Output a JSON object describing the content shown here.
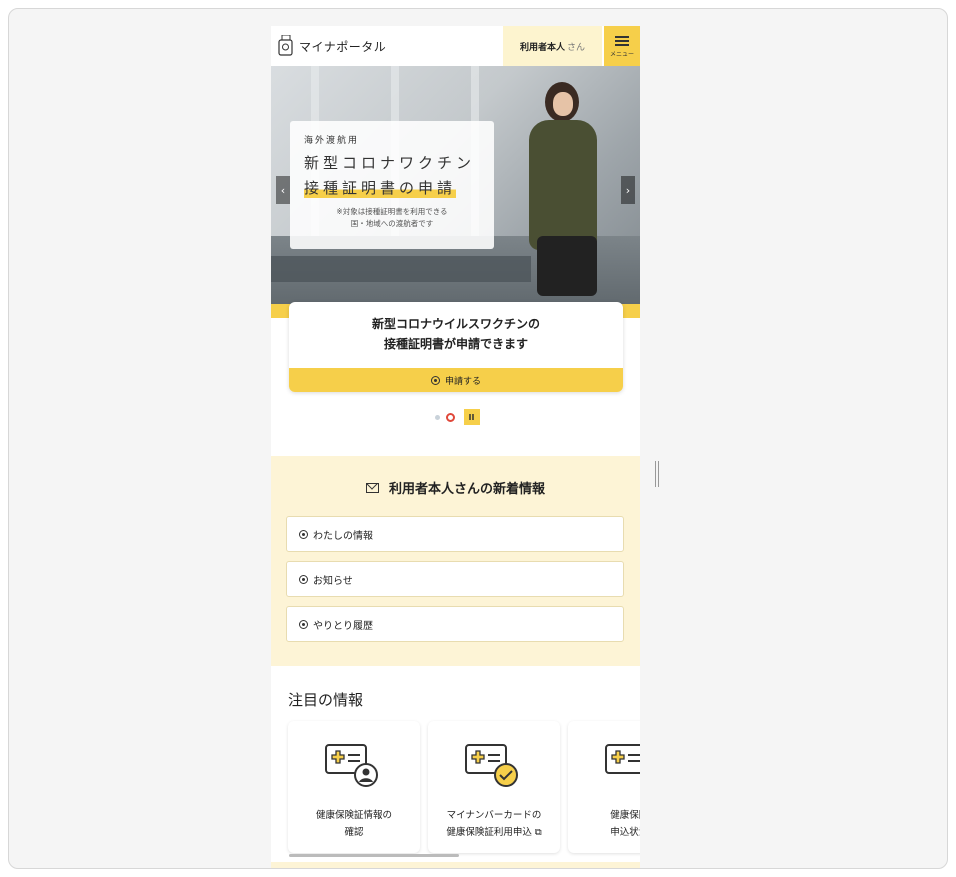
{
  "header": {
    "logo_text": "マイナポータル",
    "user_name": "利用者本人",
    "user_suffix": "さん",
    "menu_label": "メニュー"
  },
  "hero": {
    "line1": "海外渡航用",
    "line2": "新型コロナワクチン",
    "line3": "接種証明書の申請",
    "note1": "※対象は接種証明書を利用できる",
    "note2": "国・地域への渡航者です",
    "prev_arrow": "‹",
    "next_arrow": "›"
  },
  "slide_card": {
    "title1": "新型コロナウイルスワクチンの",
    "title2": "接種証明書が申請できます",
    "button": "申請する"
  },
  "carousel": {
    "pause_label": "II"
  },
  "news": {
    "title": "利用者本人さんの新着情報",
    "items": [
      {
        "label": "わたしの情報"
      },
      {
        "label": "お知らせ"
      },
      {
        "label": "やりとり履歴"
      }
    ]
  },
  "featured": {
    "title": "注目の情報",
    "cards": [
      {
        "line1": "健康保険証情報の",
        "line2": "確認"
      },
      {
        "line1": "マイナンバーカードの",
        "line2": "健康保険証利用申込 ⧉"
      },
      {
        "line1": "健康保険証",
        "line2": "申込状況を"
      }
    ]
  },
  "colors": {
    "accent_yellow": "#f6cf4a",
    "light_yellow": "#fdf4d6",
    "active_dot": "#e0483a"
  }
}
